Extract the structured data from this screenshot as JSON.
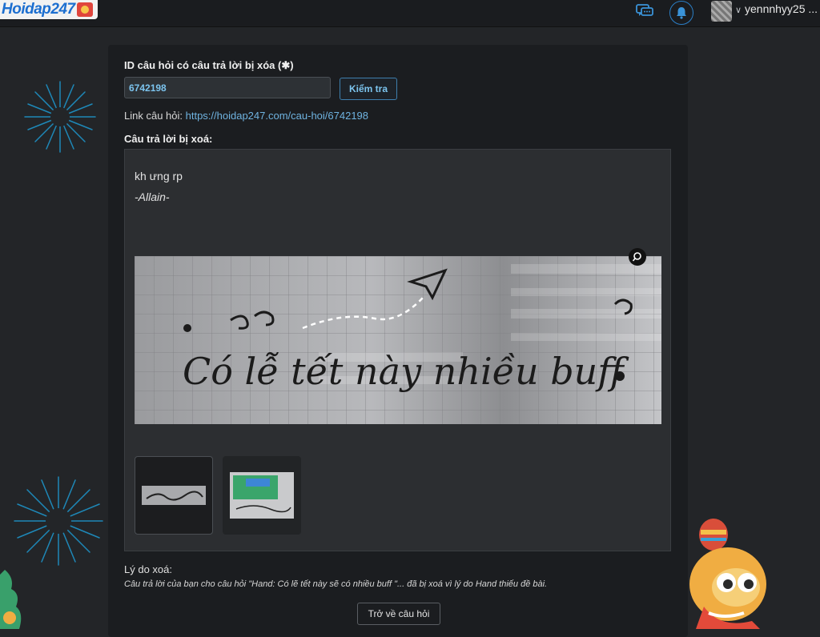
{
  "header": {
    "logo_text": "Hoidap247",
    "username": "yennnhyy25 ...",
    "icons": [
      "chat-icon",
      "bell-icon",
      "chevron-down-icon"
    ]
  },
  "form": {
    "id_label": "ID câu hỏi có câu trả lời bị xóa (✱)",
    "id_value": "6742198",
    "check_button": "Kiểm tra",
    "link_prefix": "Link câu hỏi:",
    "link_url": "https://hoidap247.com/cau-hoi/6742198",
    "deleted_answer_label": "Câu trả lời bị xoá:"
  },
  "answer": {
    "text": "kh ưng rp",
    "signature": "-Allain-",
    "image_handwriting": "Có lễ tết này nhiều buff",
    "thumbnails": [
      "thumbnail-1",
      "thumbnail-2"
    ]
  },
  "reason": {
    "label": "Lý do xoá:",
    "text": "Câu trả lời của bạn cho câu hỏi \"Hand: Có lẽ tết này sẽ có nhiều buff \"... đã bị xoá vì lý do Hand thiếu đề bài."
  },
  "back_button": "Trở về câu hỏi",
  "colors": {
    "background": "#232528",
    "card": "#1b1d20",
    "accent": "#6fb3e0",
    "firework": "#1e88b8"
  }
}
